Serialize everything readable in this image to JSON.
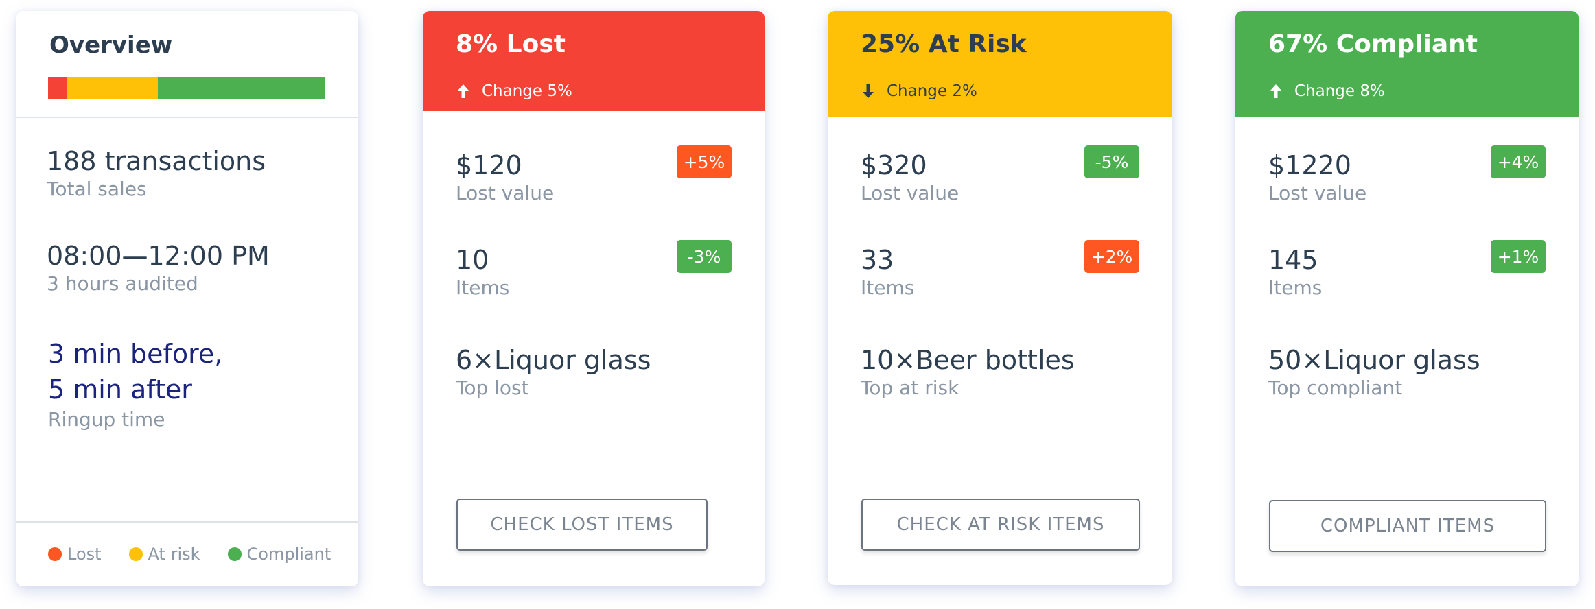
{
  "colors": {
    "lost": "#f44336",
    "at_risk": "#ffc107",
    "compliant": "#4caf50",
    "badge_up": "#ff5722",
    "badge_down": "#4caf50",
    "legend_lost": "#ff5722"
  },
  "overview": {
    "title": "Overview",
    "bar_segments": [
      {
        "name": "Lost",
        "fraction": 0.07,
        "color": "#f44336"
      },
      {
        "name": "At risk",
        "fraction": 0.325,
        "color": "#ffc107"
      },
      {
        "name": "Compliant",
        "fraction": 0.605,
        "color": "#4caf50"
      }
    ],
    "stats": [
      {
        "value": "188 transactions",
        "label": "Total sales"
      },
      {
        "value": "08:00—12:00 PM",
        "label": "3 hours audited"
      },
      {
        "value_line1": "3 min before,",
        "value_line2": "5 min after",
        "label": "Ringup time"
      }
    ],
    "legend": [
      {
        "label": "Lost",
        "color": "#ff5722"
      },
      {
        "label": "At risk",
        "color": "#ffc107"
      },
      {
        "label": "Compliant",
        "color": "#4caf50"
      }
    ]
  },
  "cards": [
    {
      "title": "8% Lost",
      "change_direction": "up",
      "change": "Change 5%",
      "header_color": "#f44336",
      "rows": [
        {
          "value": "$120",
          "label": "Lost value",
          "badge": "+5%",
          "badge_color": "#ff5722"
        },
        {
          "value": "10",
          "label": "Items",
          "badge": "-3%",
          "badge_color": "#4caf50"
        },
        {
          "value": "6×Liquor glass",
          "label": "Top lost"
        }
      ],
      "button": "CHECK LOST ITEMS"
    },
    {
      "title": "25% At Risk",
      "change_direction": "down",
      "change": "Change 2%",
      "header_color": "#ffc107",
      "rows": [
        {
          "value": "$320",
          "label": "Lost value",
          "badge": "-5%",
          "badge_color": "#4caf50"
        },
        {
          "value": "33",
          "label": "Items",
          "badge": "+2%",
          "badge_color": "#ff5722"
        },
        {
          "value": "10×Beer bottles",
          "label": "Top at risk"
        }
      ],
      "button": "CHECK AT RISK ITEMS"
    },
    {
      "title": "67% Compliant",
      "change_direction": "up",
      "change": "Change 8%",
      "header_color": "#4caf50",
      "rows": [
        {
          "value": "$1220",
          "label": "Lost value",
          "badge": "+4%",
          "badge_color": "#4caf50"
        },
        {
          "value": "145",
          "label": "Items",
          "badge": "+1%",
          "badge_color": "#4caf50"
        },
        {
          "value": "50×Liquor glass",
          "label": "Top compliant"
        }
      ],
      "button": "COMPLIANT ITEMS"
    }
  ]
}
